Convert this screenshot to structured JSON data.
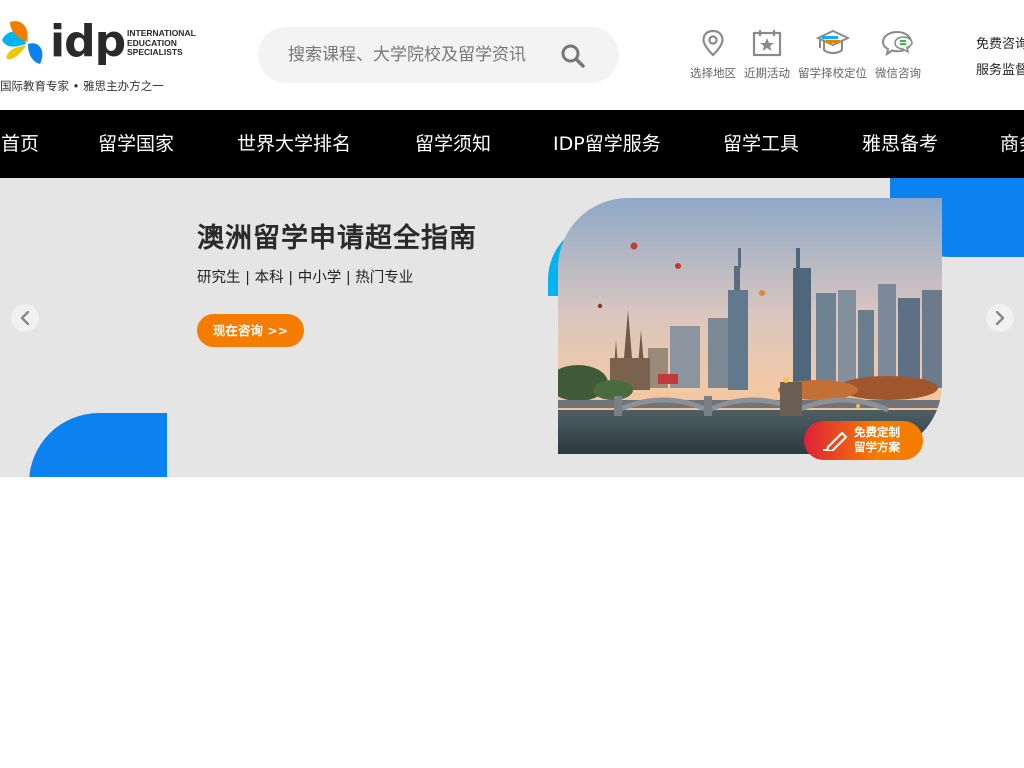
{
  "header": {
    "logo": {
      "word": "idp",
      "subtitle": "INTERNATIONAL\nEDUCATION\nSPECIALISTS",
      "tagline": "国际教育专家 • 雅思主办方之一"
    },
    "search": {
      "placeholder": "搜索课程、大学院校及留学资讯"
    },
    "tools": [
      {
        "label": "选择地区",
        "icon": "location-pin-icon"
      },
      {
        "label": "近期活动",
        "icon": "calendar-star-icon"
      },
      {
        "label": "留学择校定位",
        "icon": "graduation-cap-icon"
      },
      {
        "label": "微信咨询",
        "icon": "chat-bubbles-icon"
      }
    ],
    "aside_links": [
      "免费咨询",
      "服务监督"
    ]
  },
  "nav": {
    "items": [
      "首页",
      "留学国家",
      "世界大学排名",
      "留学须知",
      "IDP留学服务",
      "留学工具",
      "雅思备考",
      "商务合作"
    ]
  },
  "banner": {
    "title": "澳洲留学申请超全指南",
    "subtitle": "研究生 | 本科 | 中小学 | 热门专业",
    "cta": "现在咨询 >>",
    "badge": "免费定制\n留学方案"
  },
  "colors": {
    "nav_bg": "#000000",
    "banner_bg": "#e5e5e5",
    "accent_orange": "#f47c00",
    "accent_blue": "#0c82f0",
    "accent_cyan": "#00b4ef",
    "badge_red": "#e0203a"
  }
}
